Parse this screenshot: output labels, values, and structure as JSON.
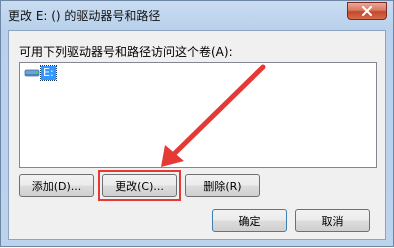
{
  "window": {
    "title": "更改 E: () 的驱动器号和路径"
  },
  "dialog": {
    "instruction_label": "可用下列驱动器号和路径访问这个卷(A):",
    "list_items": [
      {
        "label": "E:",
        "icon": "drive-icon",
        "selected": true
      }
    ]
  },
  "buttons": {
    "add": "添加(D)...",
    "change": "更改(C)...",
    "delete": "删除(R)",
    "ok": "确定",
    "cancel": "取消"
  },
  "annotation": {
    "color": "#e53935",
    "target": "change-button"
  },
  "colors": {
    "selection": "#3399ff",
    "close_button": "#c3472b"
  }
}
